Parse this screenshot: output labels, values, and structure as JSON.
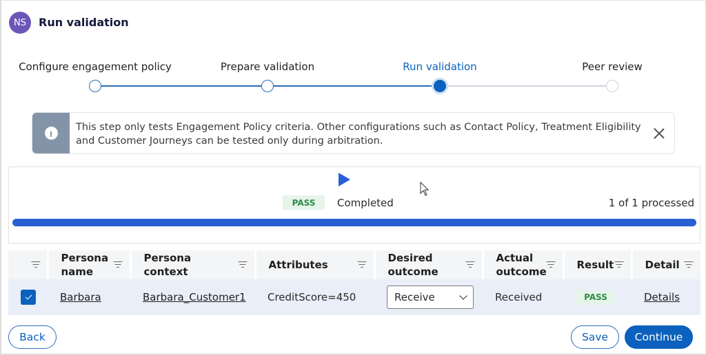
{
  "header": {
    "avatar_initials": "NS",
    "title": "Run validation"
  },
  "stepper": {
    "steps": [
      {
        "label": "Configure engagement policy",
        "state": "completed"
      },
      {
        "label": "Prepare validation",
        "state": "completed"
      },
      {
        "label": "Run validation",
        "state": "active"
      },
      {
        "label": "Peer review",
        "state": "pending"
      }
    ]
  },
  "banner": {
    "icon": "info-icon",
    "text": "This step only tests Engagement Policy criteria. Other configurations such as Contact Policy, Treatment Eligibility and Customer Journeys can be tested only during arbitration.",
    "close_icon": "close-icon"
  },
  "run": {
    "play_icon": "play-icon",
    "badge": "PASS",
    "status": "Completed",
    "processed": "1 of 1 processed",
    "progress_percent": 100
  },
  "table": {
    "columns": [
      {
        "label": ""
      },
      {
        "label": "Persona name"
      },
      {
        "label": "Persona context"
      },
      {
        "label": "Attributes"
      },
      {
        "label": "Desired outcome"
      },
      {
        "label": "Actual outcome"
      },
      {
        "label": "Result"
      },
      {
        "label": "Detail"
      }
    ],
    "rows": [
      {
        "selected": true,
        "persona_name": "Barbara",
        "persona_context": "Barbara_Customer1",
        "attributes": "CreditScore=450",
        "desired_outcome": "Receive",
        "actual_outcome": "Received",
        "result": "PASS",
        "detail": "Details"
      }
    ]
  },
  "footer": {
    "back_label": "Back",
    "save_label": "Save",
    "continue_label": "Continue"
  },
  "colors": {
    "primary": "#0b61bd",
    "avatar": "#6c57b8",
    "progress": "#2a5fd3",
    "pass_bg": "#e6f4ea",
    "pass_text": "#2e8b46",
    "banner_side": "#8494a8"
  }
}
